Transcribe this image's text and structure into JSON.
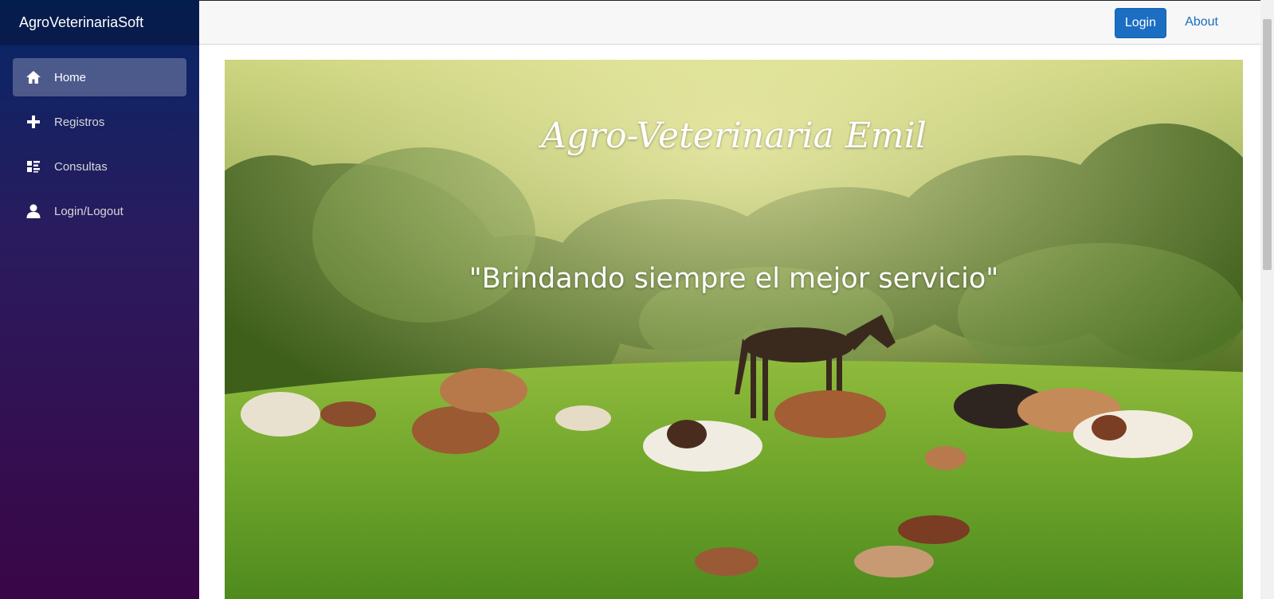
{
  "app": {
    "brand": "AgroVeterinariaSoft"
  },
  "sidebar": {
    "items": [
      {
        "label": "Home",
        "icon": "home-icon",
        "active": true
      },
      {
        "label": "Registros",
        "icon": "plus-icon",
        "active": false
      },
      {
        "label": "Consultas",
        "icon": "list-icon",
        "active": false
      },
      {
        "label": "Login/Logout",
        "icon": "person-icon",
        "active": false
      }
    ]
  },
  "topbar": {
    "login_label": "Login",
    "about_label": "About"
  },
  "hero": {
    "title": "Agro-Veterinaria Emil",
    "slogan": "\"Brindando siempre el mejor servicio\""
  },
  "colors": {
    "accent": "#1b6ec2",
    "sidebar_top": "#052767",
    "sidebar_bottom": "#3a0647"
  }
}
